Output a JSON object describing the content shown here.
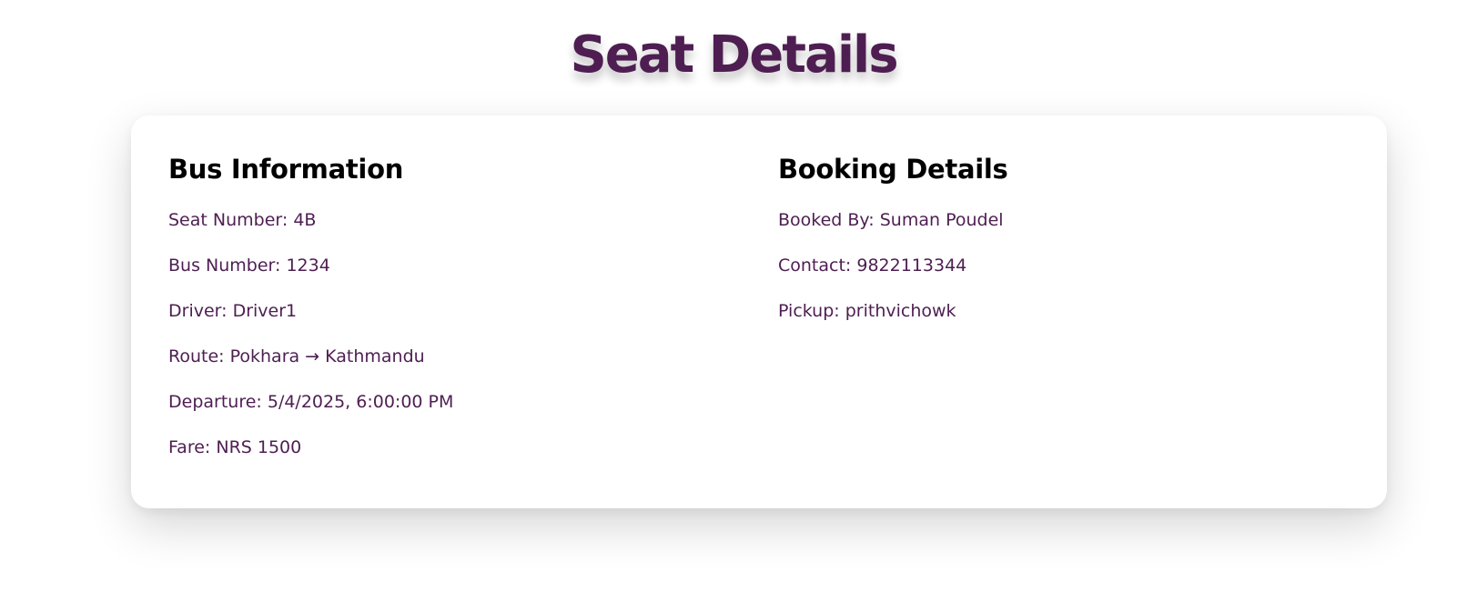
{
  "page": {
    "title": "Seat Details",
    "accent_color": "#4e1e52"
  },
  "bus_info": {
    "heading": "Bus Information",
    "seat": "Seat Number: 4B",
    "bus_number": "Bus Number: 1234",
    "driver": "Driver: Driver1",
    "route": "Route: Pokhara → Kathmandu",
    "departure": "Departure: 5/4/2025, 6:00:00 PM",
    "fare": "Fare: NRS 1500"
  },
  "booking": {
    "heading": "Booking Details",
    "booked_by": "Booked By: Suman Poudel",
    "contact": "Contact: 9822113344",
    "pickup": "Pickup: prithvichowk"
  }
}
